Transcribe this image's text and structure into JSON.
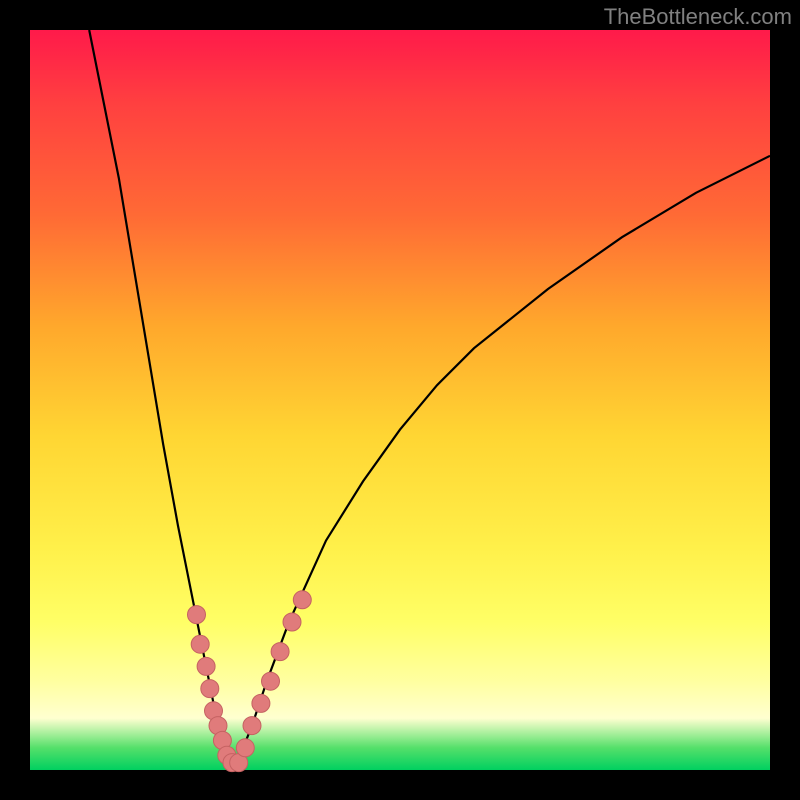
{
  "watermark": "TheBottleneck.com",
  "colors": {
    "frame": "#000000",
    "curve_stroke": "#000000",
    "marker_fill": "#e07b7b",
    "marker_stroke": "#c56262",
    "gradient_stops": [
      {
        "pct": 0,
        "hex": "#ff1a4a"
      },
      {
        "pct": 10,
        "hex": "#ff4040"
      },
      {
        "pct": 25,
        "hex": "#ff6a35"
      },
      {
        "pct": 40,
        "hex": "#ffa82c"
      },
      {
        "pct": 55,
        "hex": "#ffd633"
      },
      {
        "pct": 70,
        "hex": "#fff04a"
      },
      {
        "pct": 80,
        "hex": "#ffff66"
      },
      {
        "pct": 88,
        "hex": "#ffffa0"
      },
      {
        "pct": 93,
        "hex": "#ffffd0"
      },
      {
        "pct": 97,
        "hex": "#55e06a"
      },
      {
        "pct": 100,
        "hex": "#00d060"
      }
    ]
  },
  "chart_data": {
    "type": "line",
    "title": "",
    "xlabel": "",
    "ylabel": "",
    "xlim": [
      0,
      100
    ],
    "ylim": [
      0,
      100
    ],
    "series": [
      {
        "name": "bottleneck-curve",
        "x": [
          8,
          10,
          12,
          14,
          16,
          18,
          20,
          21,
          22,
          23,
          24,
          25,
          26,
          27,
          27.5,
          28,
          30,
          32,
          35,
          40,
          45,
          50,
          55,
          60,
          70,
          80,
          90,
          100
        ],
        "y": [
          100,
          90,
          80,
          68,
          56,
          44,
          33,
          28,
          23,
          18,
          13,
          8,
          4,
          1,
          0,
          1,
          6,
          12,
          20,
          31,
          39,
          46,
          52,
          57,
          65,
          72,
          78,
          83
        ]
      }
    ],
    "markers": [
      {
        "x": 22.5,
        "y": 21
      },
      {
        "x": 23.0,
        "y": 17
      },
      {
        "x": 23.8,
        "y": 14
      },
      {
        "x": 24.3,
        "y": 11
      },
      {
        "x": 24.8,
        "y": 8
      },
      {
        "x": 25.4,
        "y": 6
      },
      {
        "x": 26.0,
        "y": 4
      },
      {
        "x": 26.6,
        "y": 2
      },
      {
        "x": 27.3,
        "y": 1
      },
      {
        "x": 28.2,
        "y": 1
      },
      {
        "x": 29.1,
        "y": 3
      },
      {
        "x": 30.0,
        "y": 6
      },
      {
        "x": 31.2,
        "y": 9
      },
      {
        "x": 32.5,
        "y": 12
      },
      {
        "x": 33.8,
        "y": 16
      },
      {
        "x": 35.4,
        "y": 20
      },
      {
        "x": 36.8,
        "y": 23
      }
    ]
  }
}
